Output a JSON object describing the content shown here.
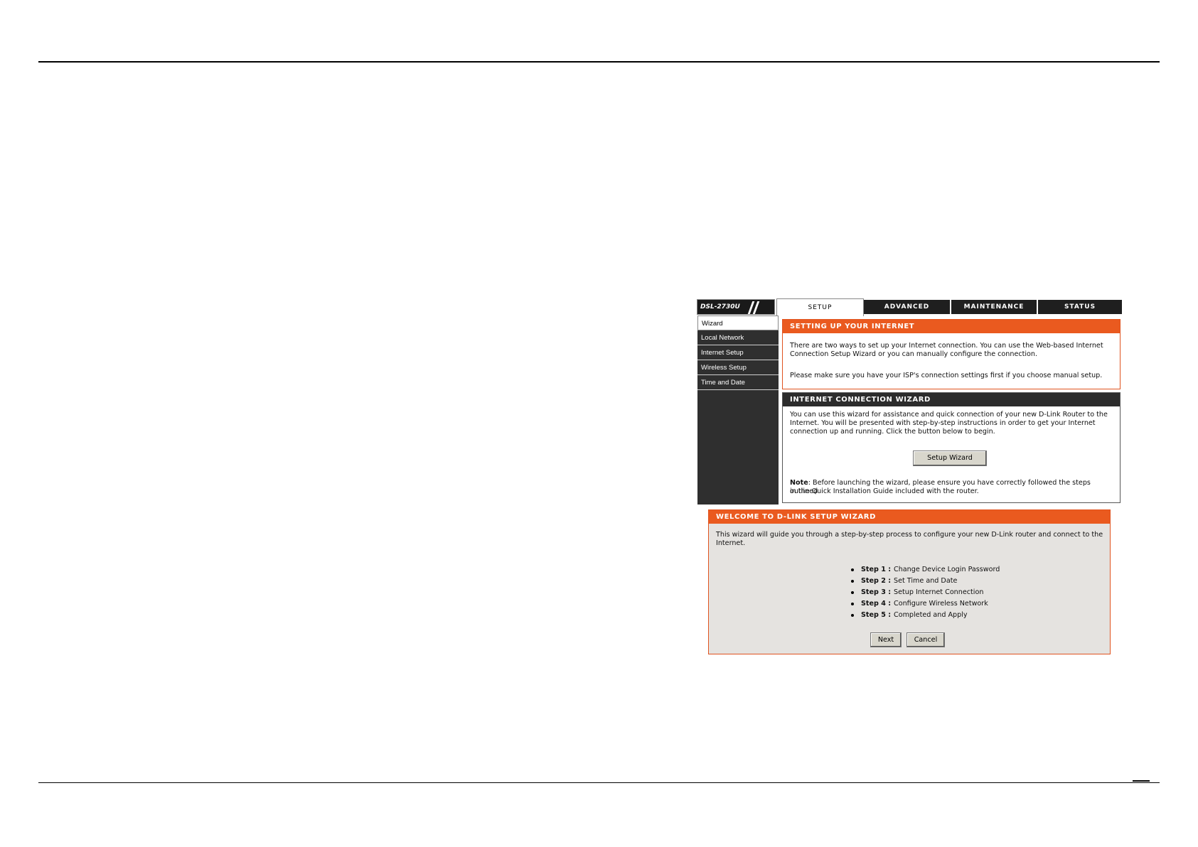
{
  "router_ui": {
    "model": "DSL-2730U",
    "tabs": [
      "SETUP",
      "ADVANCED",
      "MAINTENANCE",
      "STATUS"
    ],
    "sidebar": [
      "Wizard",
      "Local Network",
      "Internet Setup",
      "Wireless Setup",
      "Time and Date"
    ],
    "setup_internet": {
      "title": "SETTING UP YOUR INTERNET",
      "line1": "There are two ways to set up your Internet connection. You can use the Web-based Internet",
      "line2": "Connection Setup Wizard or you can manually configure the connection.",
      "line3": "Please make sure you have your ISP's connection settings first if you choose manual setup."
    },
    "connection_wizard": {
      "title": "INTERNET CONNECTION WIZARD",
      "line1": "You can use this wizard for assistance and quick connection of your new D-Link Router to the",
      "line2": "Internet. You will be presented with step-by-step instructions in order to get your Internet",
      "line3": "connection up and running. Click the button below to begin.",
      "button": "Setup Wizard",
      "note_label": "Note",
      "note_line1": ": Before launching the wizard, please ensure you have correctly followed the steps outlined",
      "note_line2": "in the Quick Installation Guide included with the router."
    }
  },
  "welcome_wizard": {
    "title": "WELCOME TO D-LINK SETUP WIZARD",
    "line1": "This wizard will guide you through a step-by-step process to configure your new D-Link router and connect to the",
    "line2": "Internet.",
    "steps": [
      {
        "label": "Step 1 :",
        "text": "Change Device Login Password"
      },
      {
        "label": "Step 2 :",
        "text": "Set Time and Date"
      },
      {
        "label": "Step 3 :",
        "text": "Setup Internet Connection"
      },
      {
        "label": "Step 4 :",
        "text": "Configure Wireless Network"
      },
      {
        "label": "Step 5 :",
        "text": "Completed and Apply"
      }
    ],
    "next_button": "Next",
    "cancel_button": "Cancel"
  },
  "colors": {
    "accent_orange": "#ea5a1f",
    "dark_header": "#2c2c2c",
    "sidebar_bg": "#2f2f2f",
    "panel_grey": "#e5e3e0"
  }
}
